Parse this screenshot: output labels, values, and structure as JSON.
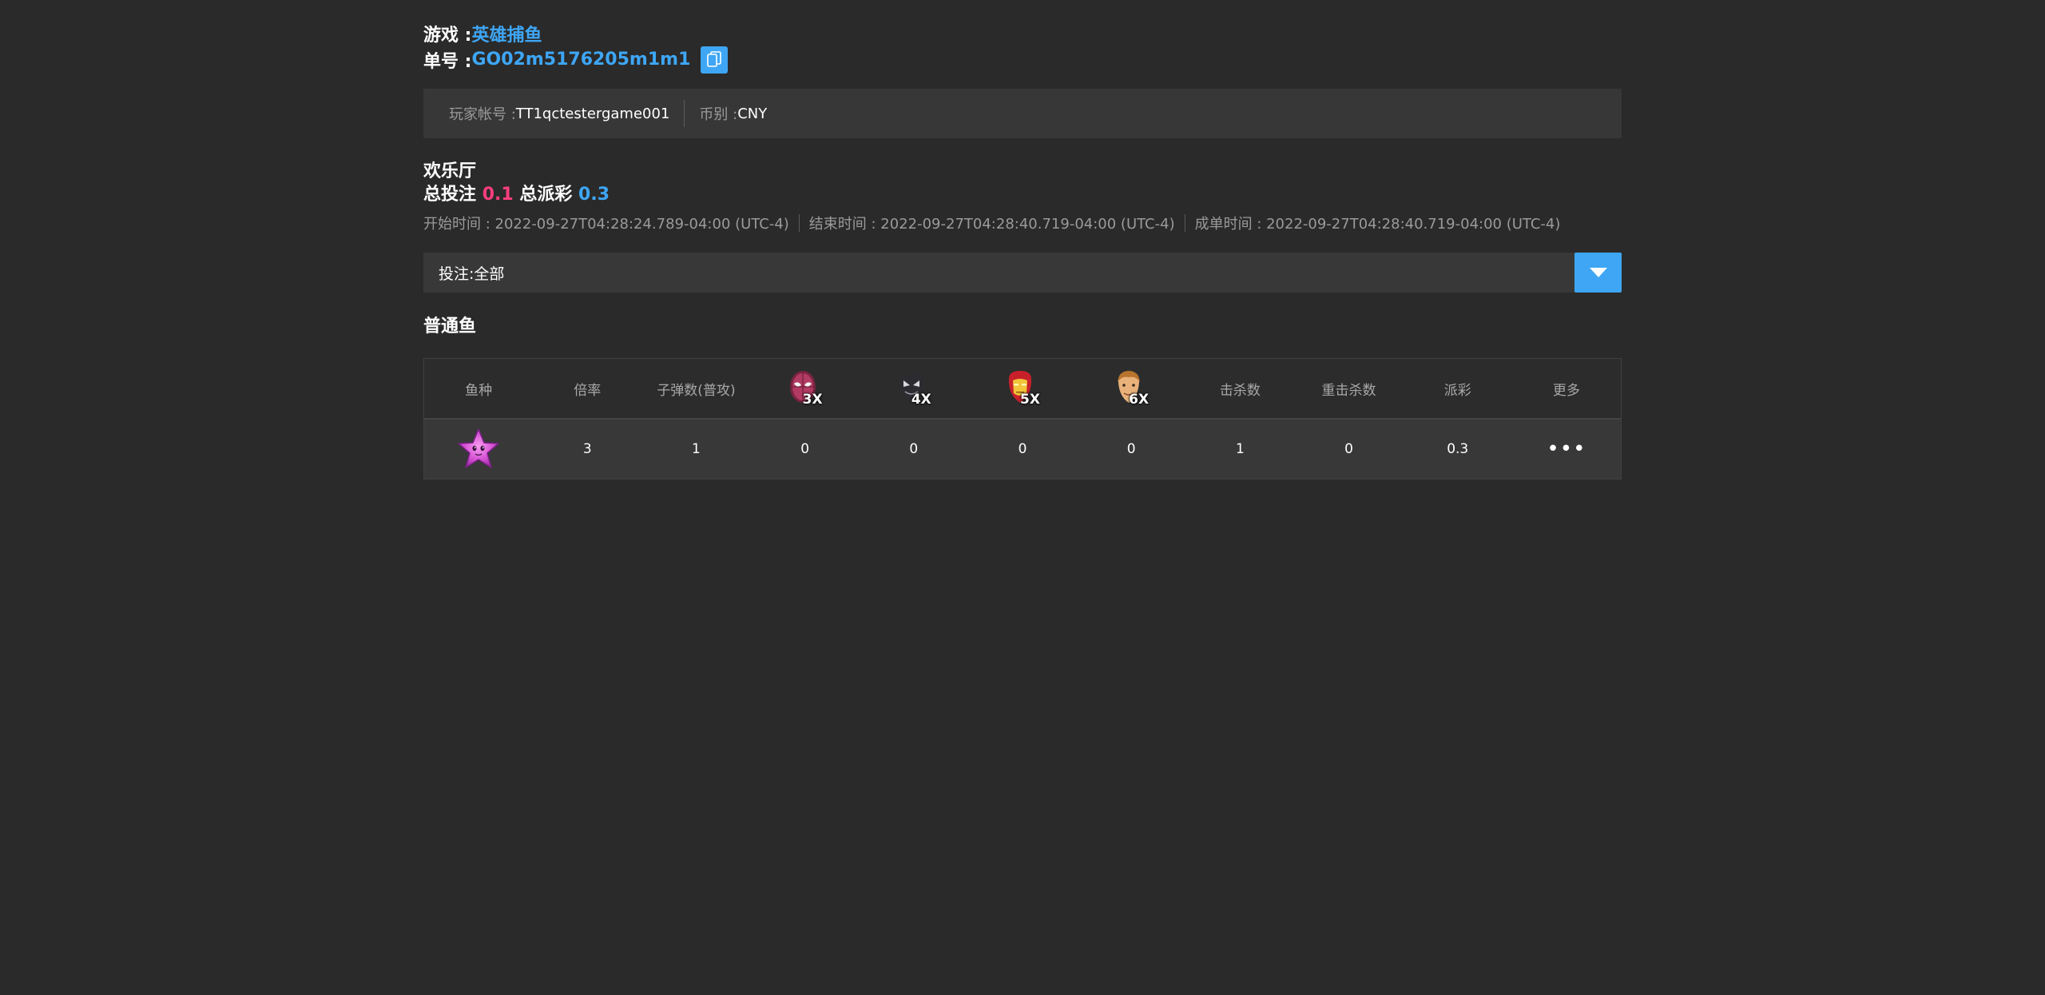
{
  "header": {
    "game_label": "游戏 : ",
    "game_name": "英雄捕鱼",
    "order_label": "单号 : ",
    "order_id": "GO02m5176205m1m1",
    "copy_icon": "copy-icon"
  },
  "info": {
    "player_label": "玩家帐号 : ",
    "player_value": "TT1qctestergame001",
    "currency_label": "币别 : ",
    "currency_value": "CNY"
  },
  "room": {
    "name": "欢乐厅",
    "total_bet_label": "总投注",
    "total_bet_value": "0.1",
    "total_payout_label": "总派彩",
    "total_payout_value": "0.3"
  },
  "times": {
    "start": "开始时间 : 2022-09-27T04:28:24.789-04:00 (UTC-4)",
    "end": "结束时间 : 2022-09-27T04:28:40.719-04:00 (UTC-4)",
    "settle": "成单时间 : 2022-09-27T04:28:40.719-04:00 (UTC-4)"
  },
  "filter": {
    "label": "投注: ",
    "value": "全部",
    "icon": "caret-down-icon"
  },
  "section": {
    "title": "普通鱼"
  },
  "table": {
    "headers": {
      "fish": "鱼种",
      "rate": "倍率",
      "bullets": "子弹数(普攻)",
      "hero1_mult": "3X",
      "hero2_mult": "4X",
      "hero3_mult": "5X",
      "hero4_mult": "6X",
      "kills": "击杀数",
      "crit_kills": "重击杀数",
      "payout": "派彩",
      "more": "更多"
    },
    "hero_icons": [
      "spider-hero-icon",
      "panther-hero-icon",
      "iron-hero-icon",
      "star-lord-hero-icon"
    ],
    "row": {
      "fish_icon": "starfish-icon",
      "rate": "3",
      "bullets": "1",
      "hero1": "0",
      "hero2": "0",
      "hero3": "0",
      "hero4": "0",
      "kills": "1",
      "crit_kills": "0",
      "payout": "0.3",
      "more": "•••"
    }
  },
  "colors": {
    "accent": "#3ea6f5",
    "bet": "#ff3d7f",
    "background": "#2a2a2a"
  }
}
